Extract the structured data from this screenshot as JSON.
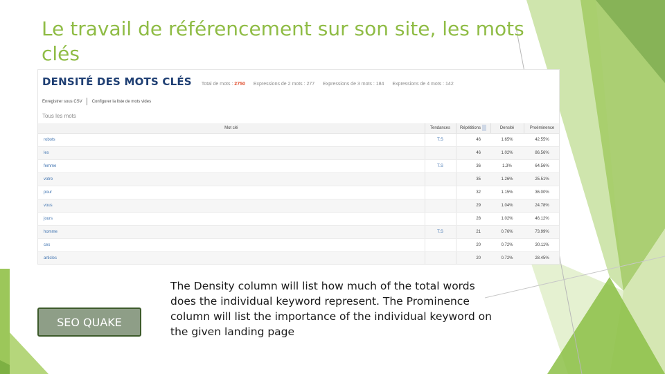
{
  "slide": {
    "title": "Le travail de référencement sur son site, les mots clés",
    "accent_color": "#8fbc45"
  },
  "screenshot": {
    "title": "DENSITÉ DES MOTS CLÉS",
    "stats": {
      "total_label": "Total de mots :",
      "total_value": "2750",
      "two_words": "Expressions de 2 mots : 277",
      "three_words": "Expressions de 3 mots : 184",
      "four_words": "Expressions de 4 mots : 142"
    },
    "actions": {
      "csv": "Enregistrer sous CSV",
      "stopwords": "Configurer la liste de mots vides"
    },
    "subtitle": "Tous les mots",
    "columns": {
      "word": "Mot clé",
      "trends": "Tendances",
      "repetitions": "Répétitions",
      "density": "Densité",
      "prominence": "Proéminence"
    },
    "rows": [
      {
        "word": "robots",
        "trend": "T.S",
        "repetitions": "46",
        "density": "1.65%",
        "prominence": "42.55%"
      },
      {
        "word": "les",
        "trend": "",
        "repetitions": "46",
        "density": "1.02%",
        "prominence": "86.56%"
      },
      {
        "word": "femme",
        "trend": "T.S",
        "repetitions": "36",
        "density": "1.3%",
        "prominence": "64.56%"
      },
      {
        "word": "votre",
        "trend": "",
        "repetitions": "35",
        "density": "1.26%",
        "prominence": "25.51%"
      },
      {
        "word": "pour",
        "trend": "",
        "repetitions": "32",
        "density": "1.15%",
        "prominence": "36.00%"
      },
      {
        "word": "vous",
        "trend": "",
        "repetitions": "29",
        "density": "1.04%",
        "prominence": "24.78%"
      },
      {
        "word": "jours",
        "trend": "",
        "repetitions": "28",
        "density": "1.02%",
        "prominence": "46.12%"
      },
      {
        "word": "homme",
        "trend": "T.S",
        "repetitions": "21",
        "density": "0.76%",
        "prominence": "73.99%"
      },
      {
        "word": "ces",
        "trend": "",
        "repetitions": "20",
        "density": "0.72%",
        "prominence": "30.11%"
      },
      {
        "word": "articles",
        "trend": "",
        "repetitions": "20",
        "density": "0.72%",
        "prominence": "28.45%"
      }
    ]
  },
  "button": {
    "label": "SEO QUAKE"
  },
  "description": "The Density column will list how much of the total words does the individual keyword represent. The Prominence column will list the importance of the individual keyword on the given landing page"
}
